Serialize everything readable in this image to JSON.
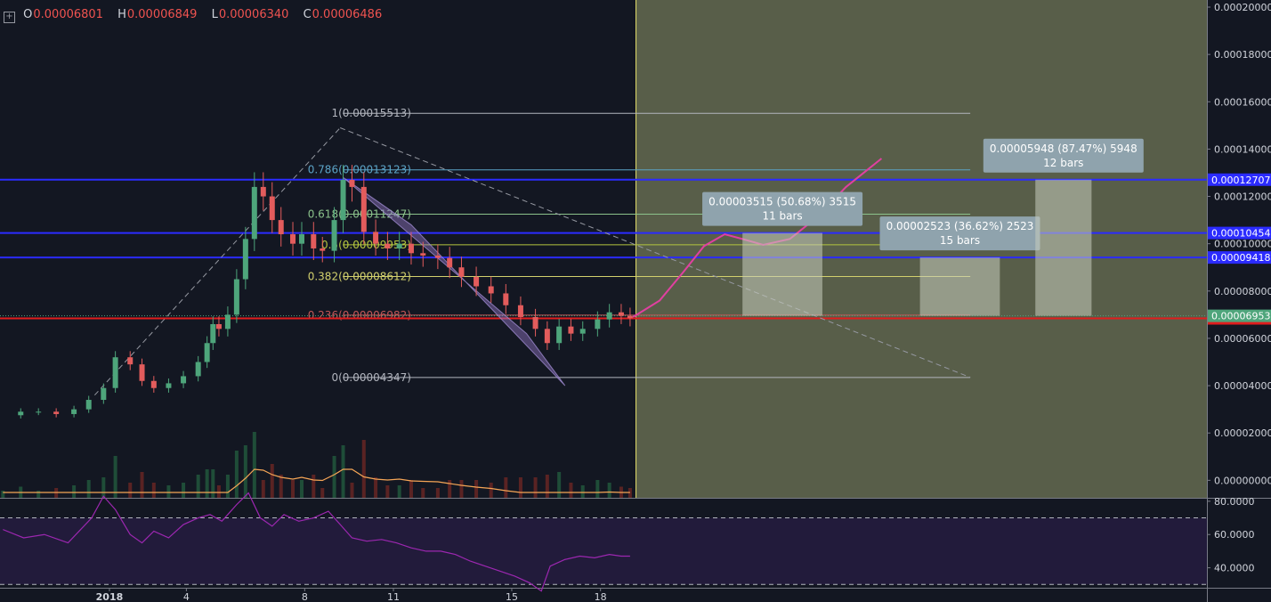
{
  "legend": {
    "open_key": "O",
    "open": "0.00006801",
    "high_key": "H",
    "high": "0.00006849",
    "low_key": "L",
    "low": "0.00006340",
    "close_key": "C",
    "close": "0.00006486",
    "icon": "plus-square-icon"
  },
  "chart_data": [
    {
      "type": "line",
      "title": "",
      "price_axis": {
        "ylim": [
          -1e-06,
          0.0002
        ],
        "ticks": [
          "0.00000000",
          "0.00002000",
          "0.00004000",
          "0.00006000",
          "0.00008000",
          "0.00010000",
          "0.00012000",
          "0.00014000",
          "0.00016000",
          "0.00018000",
          "0.00020000"
        ]
      },
      "time_axis": {
        "tick_labels": [
          {
            "label": "2018",
            "x": 0.4
          },
          {
            "label": "4",
            "x": 3
          },
          {
            "label": "8",
            "x": 7
          },
          {
            "label": "11",
            "x": 10
          },
          {
            "label": "15",
            "x": 14
          },
          {
            "label": "18",
            "x": 17
          }
        ],
        "xlim": [
          -3.3,
          37.5
        ]
      },
      "series": [
        {
          "kind": "price_path",
          "points": [
            [
              -3.2,
              2.75e-05
            ],
            [
              -2.6,
              2.9e-05
            ],
            [
              -2.0,
              2.9e-05
            ],
            [
              -1.4,
              2.8e-05
            ],
            [
              -0.8,
              3e-05
            ],
            [
              -0.3,
              3.4e-05
            ],
            [
              0.2,
              3.9e-05
            ],
            [
              0.6,
              5.2e-05
            ],
            [
              1.1,
              4.9e-05
            ],
            [
              1.5,
              4.2e-05
            ],
            [
              1.9,
              3.9e-05
            ],
            [
              2.4,
              4.1e-05
            ],
            [
              2.9,
              4.4e-05
            ],
            [
              3.4,
              5e-05
            ],
            [
              3.7,
              5.8e-05
            ],
            [
              3.9,
              6.6e-05
            ],
            [
              4.1,
              6.4e-05
            ],
            [
              4.4,
              7e-05
            ],
            [
              4.7,
              8.5e-05
            ],
            [
              5.0,
              0.000102
            ],
            [
              5.3,
              0.000124
            ],
            [
              5.6,
              0.00012
            ],
            [
              5.9,
              0.00011
            ],
            [
              6.2,
              0.000104
            ],
            [
              6.6,
              0.0001
            ],
            [
              6.9,
              0.000104
            ],
            [
              7.3,
              9.8e-05
            ],
            [
              7.6,
              9.7e-05
            ],
            [
              8.0,
              0.00011
            ],
            [
              8.3,
              0.000127
            ],
            [
              8.6,
              0.000124
            ],
            [
              9.0,
              0.000105
            ],
            [
              9.4,
              0.0001
            ],
            [
              9.8,
              9.8e-05
            ],
            [
              10.2,
              0.0001
            ],
            [
              10.6,
              9.6e-05
            ],
            [
              11.0,
              9.5e-05
            ],
            [
              11.5,
              9.4e-05
            ],
            [
              11.9,
              9e-05
            ],
            [
              12.3,
              8.6e-05
            ],
            [
              12.8,
              8.2e-05
            ],
            [
              13.3,
              7.9e-05
            ],
            [
              13.8,
              7.4e-05
            ],
            [
              14.3,
              6.9e-05
            ],
            [
              14.8,
              6.4e-05
            ],
            [
              15.2,
              5.8e-05
            ],
            [
              15.6,
              6.5e-05
            ],
            [
              16.0,
              6.2e-05
            ],
            [
              16.4,
              6.4e-05
            ],
            [
              16.9,
              6.8e-05
            ],
            [
              17.3,
              7.1e-05
            ],
            [
              17.7,
              6.95e-05
            ],
            [
              18.0,
              6.85e-05
            ]
          ]
        },
        {
          "kind": "projection",
          "name": "",
          "color": "#e040a0",
          "points": [
            [
              18.1,
              6.9e-05
            ],
            [
              19.0,
              7.6e-05
            ],
            [
              19.8,
              8.8e-05
            ],
            [
              20.5,
              9.9e-05
            ],
            [
              21.2,
              0.000104
            ],
            [
              21.8,
              0.000102
            ],
            [
              22.5,
              9.95e-05
            ],
            [
              23.4,
              0.000102
            ],
            [
              24.3,
              0.000111
            ],
            [
              25.3,
              0.000124
            ],
            [
              26.0,
              0.000131
            ],
            [
              26.5,
              0.000136
            ]
          ]
        },
        {
          "kind": "rsi",
          "ylim": [
            28,
            81
          ],
          "ticks": [
            "80.0000",
            "60.0000",
            "40.0000"
          ],
          "bands": [
            70,
            30
          ],
          "points": [
            [
              -3.2,
              63
            ],
            [
              -2.5,
              58
            ],
            [
              -1.8,
              60
            ],
            [
              -1.0,
              55
            ],
            [
              -0.2,
              70
            ],
            [
              0.2,
              83
            ],
            [
              0.6,
              75
            ],
            [
              1.1,
              60
            ],
            [
              1.5,
              55
            ],
            [
              1.9,
              62
            ],
            [
              2.4,
              58
            ],
            [
              2.9,
              66
            ],
            [
              3.4,
              70
            ],
            [
              3.8,
              72
            ],
            [
              4.2,
              68
            ],
            [
              4.7,
              78
            ],
            [
              5.1,
              85
            ],
            [
              5.5,
              70
            ],
            [
              5.9,
              65
            ],
            [
              6.3,
              72
            ],
            [
              6.8,
              68
            ],
            [
              7.3,
              70
            ],
            [
              7.8,
              74
            ],
            [
              8.2,
              66
            ],
            [
              8.6,
              58
            ],
            [
              9.1,
              56
            ],
            [
              9.6,
              57
            ],
            [
              10.1,
              55
            ],
            [
              10.6,
              52
            ],
            [
              11.1,
              50
            ],
            [
              11.6,
              50
            ],
            [
              12.1,
              48
            ],
            [
              12.6,
              44
            ],
            [
              13.1,
              41
            ],
            [
              13.6,
              38
            ],
            [
              14.1,
              35
            ],
            [
              14.6,
              31
            ],
            [
              15.0,
              26
            ],
            [
              15.3,
              41
            ],
            [
              15.8,
              45
            ],
            [
              16.3,
              47
            ],
            [
              16.8,
              46
            ],
            [
              17.3,
              48
            ],
            [
              17.7,
              47
            ],
            [
              18.0,
              47
            ]
          ]
        }
      ],
      "fib_levels": [
        {
          "ratio": "1",
          "value": "0.00015513",
          "price": 0.00015513,
          "color": "#b2b5be"
        },
        {
          "ratio": "0.786",
          "value": "0.00013123",
          "price": 0.00013123,
          "color": "#5ba3c6"
        },
        {
          "ratio": "0.618",
          "value": "0.00011247",
          "price": 0.00011247,
          "color": "#8bc28b"
        },
        {
          "ratio": "0.5",
          "value": "0.00009953",
          "price": 9.953e-05,
          "color": "#b5c63f"
        },
        {
          "ratio": "0.382",
          "value": "0.00008612",
          "price": 8.612e-05,
          "color": "#d2d06d"
        },
        {
          "ratio": "0.236",
          "value": "0.00006982",
          "price": 6.982e-05,
          "color": "#c25757"
        },
        {
          "ratio": "0",
          "value": "0.00004347",
          "price": 4.347e-05,
          "color": "#b2b5be"
        }
      ],
      "horizontal_levels": [
        {
          "value": "0.00012707",
          "price": 0.00012707,
          "color": "#2b2bff"
        },
        {
          "value": "0.00010454",
          "price": 0.00010454,
          "color": "#2b2bff"
        },
        {
          "value": "0.00009418",
          "price": 9.418e-05,
          "color": "#2b2bff"
        },
        {
          "value": "0.00006844",
          "price": 6.844e-05,
          "color": "#e01e1e"
        }
      ],
      "last_price": {
        "value": "0.00006953",
        "price": 6.953e-05,
        "color": "#4ea57b"
      },
      "projections": [
        {
          "line1": "0.00003515 (50.68%) 3515",
          "line2": "11 bars",
          "x0": 21.8,
          "x1": 24.5,
          "low": 6.953e-05,
          "high": 0.00010454
        },
        {
          "line1": "0.00002523 (36.62%) 2523",
          "line2": "15 bars",
          "x0": 27.8,
          "x1": 30.5,
          "low": 6.953e-05,
          "high": 9.418e-05
        },
        {
          "line1": "0.00005948 (87.47%) 5948",
          "line2": "12 bars",
          "x0": 31.7,
          "x1": 33.6,
          "low": 6.953e-05,
          "high": 0.00012707
        }
      ],
      "channel": [
        [
          8.3,
          0.000128
        ],
        [
          10.6,
          0.000108
        ],
        [
          15.8,
          4e-05
        ],
        [
          14.5,
          6.2e-05
        ]
      ],
      "trend_lines": [
        {
          "style": "dashed",
          "points": [
            [
              -0.1,
              3.6e-05
            ],
            [
              8.2,
              0.000149
            ]
          ]
        },
        {
          "style": "dashed",
          "points": [
            [
              8.2,
              0.000149
            ],
            [
              29.5,
              4.35e-05
            ]
          ]
        }
      ],
      "forecast_divider_x": 18.2,
      "colors": {
        "background": "#131722",
        "forecast_zone": "#585e49",
        "rsi_fill": "#221b3b",
        "rsi_line": "#9c27b0",
        "volume_ma": "#f5a556",
        "up": "#4ea57b",
        "down": "#e35c5c"
      }
    }
  ]
}
